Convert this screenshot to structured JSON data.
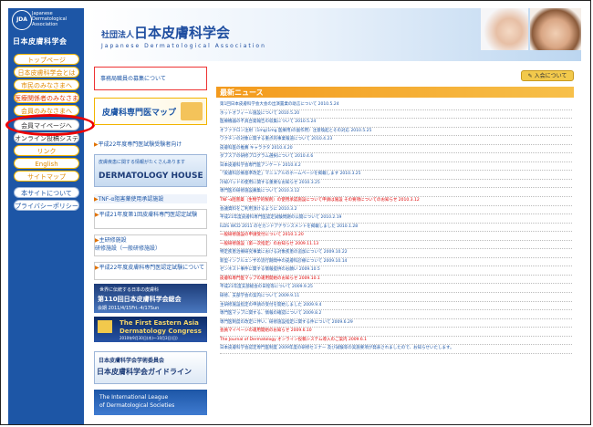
{
  "logo": {
    "mark": "JDA",
    "text_line1": "Japanese",
    "text_line2": "Dermatological",
    "text_line3": "Association"
  },
  "sidebar": {
    "site_name": "日本皮膚科学会",
    "nav": [
      {
        "label": "トップページ",
        "style": "y"
      },
      {
        "label": "日本皮膚科学会とは",
        "style": "y"
      },
      {
        "label": "市民のみなさまへ",
        "style": "y"
      },
      {
        "label": "医療関係者のみなさまへ",
        "style": "red"
      },
      {
        "label": "会員のみなさまへ",
        "style": "y"
      },
      {
        "label": "会員マイページへ",
        "style": "w"
      },
      {
        "label": "オンライン投稿システム",
        "style": "w"
      },
      {
        "label": "リンク",
        "style": "y"
      },
      {
        "label": "English",
        "style": "y"
      },
      {
        "label": "サイトマップ",
        "style": "y"
      },
      {
        "label": "本サイトについて",
        "style": "blue"
      },
      {
        "label": "プライバシーポリシー",
        "style": "blue"
      }
    ]
  },
  "header": {
    "title_prefix": "社団法人",
    "title": "日本皮膚科学会",
    "subtitle": "Japanese Dermatological Association"
  },
  "left_column": {
    "recruit": "事務局職員の募集について",
    "map_title": "皮膚科専門医マップ",
    "exam_link": "平成22年度専門医試験受験者向け",
    "house_top": "皮膚疾患に関する情報がたくさんあります",
    "house_title": "DERMATOLOGY HOUSE",
    "tnf": "TNF-α阻害薬使用承認施設",
    "specialist_link": "平成21年度第1回皮膚科専門医認定試験",
    "training_title": "主研修施設",
    "training_sub": "研修施設（一般研修施設）",
    "specialist2": "平成22年度皮膚科専門医認定試験について",
    "congress_top": "世界に伝統する日本の皮膚科",
    "congress_title": "第110回日本皮膚科学会総会",
    "congress_date": "会期 2011/4/15Fri.-4/17Sun",
    "eadc_title": "The First Eastern Asia",
    "eadc_sub": "Dermatology Congress",
    "eadc_date": "2010年9月30日(木)〜10月3日(日)",
    "guideline_top": "日本皮膚科学会学術委員会",
    "guideline_title": "日本皮膚科学会ガイドライン",
    "ilds_line1": "The International League",
    "ilds_line2": "of Dermatological Societies"
  },
  "right_column": {
    "join_button": "入会について",
    "news_header": "最新ニュース",
    "news": [
      {
        "text": "第1回日本皮膚科学会大会の出演置業の助言について 2010.5.24",
        "red": false
      },
      {
        "text": "ホットオフィール施設について 2010.5.20",
        "red": false
      },
      {
        "text": "医療機器の不具合発報告の収集について 2010.5.24",
        "red": false
      },
      {
        "text": "オファクロン注射（1mg(1mg 医療用)の副作用）注意喚起とその対応 2010.5.25",
        "red": false
      },
      {
        "text": "ワクチンの対象に関する重点的事業報道について 2010.4.23",
        "red": false
      },
      {
        "text": "皮膚科医の推薦 キャラクタ 2010.4.20",
        "red": false
      },
      {
        "text": "ダブスアの研修プログラム選択について 2010.4.6",
        "red": false
      },
      {
        "text": "日本皮膚科学会専門医アンケート 2010.4.2",
        "red": false
      },
      {
        "text": "「皮膚科診療基準改定」マニュアルのホームページを掲載します 2010.3.25",
        "red": false
      },
      {
        "text": "冷却パッドの使用に関する重要なお知らせ 2010.3.25",
        "red": false
      },
      {
        "text": "専門医の研修施設募集について 2010.3.12",
        "red": false
      },
      {
        "text": "TNF-α阻害薬（生物学的製剤）の使用承認施設について申請は施設 その要項についてのお知らせ 2010.3.12",
        "red": true
      },
      {
        "text": "会議資料をご利用頂けるように 2010.3.2",
        "red": false
      },
      {
        "text": "平成21年度皮膚科専門医認定試験問題の公開について 2010.2.19",
        "red": false
      },
      {
        "text": "ILDS WCD 2011 のセカンドアナウンスメントを掲載しました 2010.1.28",
        "red": false
      },
      {
        "text": "一般研修施設の申請受付について 2010.1.20",
        "red": true
      },
      {
        "text": "一般研修施設（第一次指定）のお知らせ 2009.11.13",
        "red": true
      },
      {
        "text": "特定疾患治療研究事業における対象疾患の追加について 2009.10.22",
        "red": false
      },
      {
        "text": "新型インフルエンザの流行期間中の皮膚科診療について 2009.10.14",
        "red": false
      },
      {
        "text": "ゼンネスト事件に関する情報提供のお願い 2009.10.5",
        "red": false
      },
      {
        "text": "皮膚科専門医マップの運用開始のお知らせ 2009.10.1",
        "red": true
      },
      {
        "text": "平成21年度支部総会の日程等について 2009.9.25",
        "red": false
      },
      {
        "text": "研修、支部学会の案内について 2009.9.11",
        "red": false
      },
      {
        "text": "主研修施設指定の申請の受付を開始しました 2009.9.4",
        "red": false
      },
      {
        "text": "専門医マップに関する、情報の確認について 2009.8.2",
        "red": false
      },
      {
        "text": "専門医制度の改定に伴い、研修施設指定に関する件について 2009.6.29",
        "red": false
      },
      {
        "text": "会員マイページの運用開始のお知らせ 2009.6.10",
        "red": true
      },
      {
        "text": "The Journal of Dermatology オンライン投稿システム導入のご案内 2009.6.1",
        "red": true
      },
      {
        "text": "日本皮膚科学会認定専門医制度 2009年度の研修セミナー 及び試験等の実施要項が発表されましたので、お知らせいたします。",
        "red": false
      }
    ]
  }
}
